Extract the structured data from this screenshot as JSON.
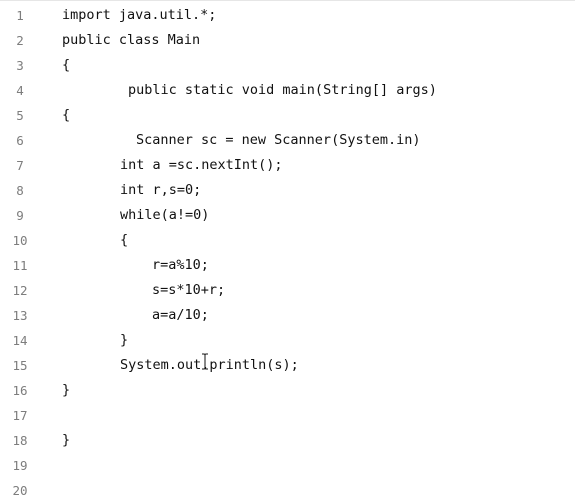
{
  "editor": {
    "lines": [
      {
        "number": "1",
        "text": "import java.util.*;"
      },
      {
        "number": "2",
        "text": "public class Main"
      },
      {
        "number": "3",
        "text": "{"
      },
      {
        "number": "4",
        "text": "public static void main(String[] args)"
      },
      {
        "number": "5",
        "text": "{"
      },
      {
        "number": "6",
        "text": "Scanner sc = new Scanner(System.in)"
      },
      {
        "number": "7",
        "text": "int a =sc.nextInt();"
      },
      {
        "number": "8",
        "text": "int r,s=0;"
      },
      {
        "number": "9",
        "text": "while(a!=0)"
      },
      {
        "number": "10",
        "text": "{"
      },
      {
        "number": "11",
        "text": "r=a%10;"
      },
      {
        "number": "12",
        "text": "s=s*10+r;"
      },
      {
        "number": "13",
        "text": "a=a/10;"
      },
      {
        "number": "14",
        "text": "}"
      },
      {
        "number": "15",
        "text": "System.out.println(s);"
      },
      {
        "number": "16",
        "text": "}"
      },
      {
        "number": "17",
        "text": ""
      },
      {
        "number": "18",
        "text": "}"
      },
      {
        "number": "19",
        "text": ""
      },
      {
        "number": "20",
        "text": ""
      }
    ],
    "cursor_icon": "text-cursor-icon"
  }
}
